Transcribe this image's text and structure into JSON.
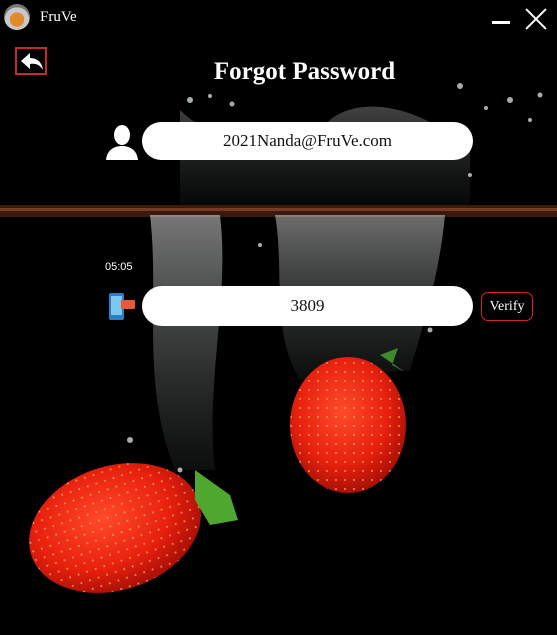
{
  "window": {
    "title": "FruVe",
    "logo_icon": "fruit-logo-icon",
    "minimize_icon": "minimize-icon",
    "close_icon": "close-icon"
  },
  "nav": {
    "back_icon": "back-arrow-icon",
    "accent_color": "#c62a2a"
  },
  "page": {
    "title": "Forgot Password",
    "background": "strawberries-splashing-into-water photo on black"
  },
  "form": {
    "email": {
      "icon": "user-icon",
      "value": "2021Nanda@FruVe.com"
    },
    "timer": "05:05",
    "otp": {
      "icon": "phone-icon",
      "value": "3809"
    },
    "verify_label": "Verify"
  }
}
